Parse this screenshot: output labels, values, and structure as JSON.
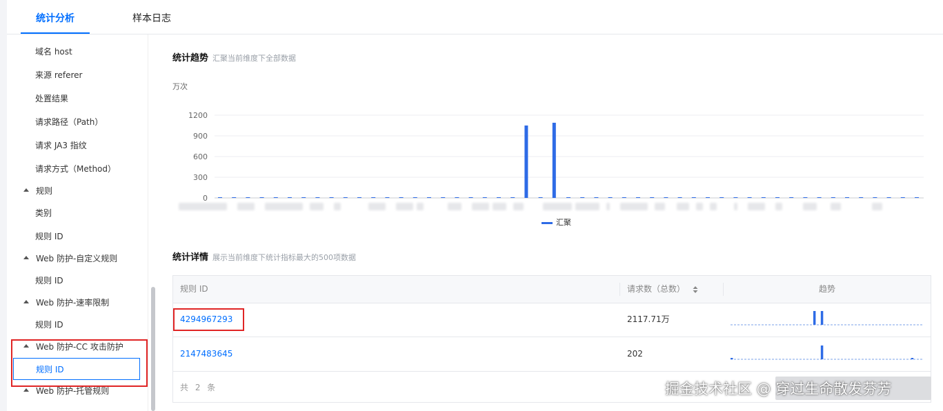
{
  "tabs": [
    {
      "label": "统计分析"
    },
    {
      "label": "样本日志"
    }
  ],
  "sidebar": {
    "items": [
      {
        "label": "域名 host"
      },
      {
        "label": "来源 referer"
      },
      {
        "label": "处置结果"
      },
      {
        "label": "请求路径（Path）"
      },
      {
        "label": "请求 JA3 指纹"
      },
      {
        "label": "请求方式（Method）"
      },
      {
        "label": "规则"
      },
      {
        "label": "类别"
      },
      {
        "label": "规则 ID"
      },
      {
        "label": "Web 防护-自定义规则"
      },
      {
        "label": "规则 ID"
      },
      {
        "label": "Web 防护-速率限制"
      },
      {
        "label": "规则 ID"
      },
      {
        "label": "Web 防护-CC 攻击防护"
      },
      {
        "label": "规则 ID"
      },
      {
        "label": "Web 防护-托管规则"
      }
    ]
  },
  "trend": {
    "title": "统计趋势",
    "subtitle": "汇聚当前维度下全部数据",
    "unit": "万次"
  },
  "chart_data": {
    "type": "bar",
    "yticks": [
      "1200",
      "900",
      "600",
      "300",
      "0"
    ],
    "ylim": [
      0,
      1200
    ],
    "grid": true,
    "legend_position": "bottom",
    "series": [
      {
        "name": "汇聚",
        "color": "#2e6be6",
        "values": [
          0,
          0,
          0,
          0,
          0,
          0,
          0,
          0,
          0,
          0,
          0,
          0,
          0,
          0,
          0,
          0,
          0,
          0,
          0,
          0,
          0,
          0,
          1050,
          0,
          1090,
          0,
          0,
          0,
          0,
          0,
          0,
          0,
          0,
          0,
          0,
          0,
          0,
          0,
          0,
          0,
          0,
          0,
          0,
          0,
          0,
          0,
          0,
          0,
          0,
          0,
          0
        ]
      }
    ]
  },
  "details": {
    "title": "统计详情",
    "subtitle": "展示当前维度下统计指标最大的500项数据",
    "columns": {
      "rule_id": "规则 ID",
      "requests": "请求数（总数）",
      "trend": "趋势"
    },
    "sort_icon": "sort-icon",
    "rows": [
      {
        "rule_id": "4294967293",
        "requests": "2117.71万",
        "spark": [
          0,
          0,
          0,
          0,
          0,
          0,
          0,
          0,
          0,
          0,
          0,
          0,
          0,
          0,
          0,
          0,
          0,
          0,
          0,
          0,
          0,
          0,
          1,
          0,
          1,
          0,
          0,
          0,
          0,
          0,
          0,
          0,
          0,
          0,
          0,
          0,
          0,
          0,
          0,
          0,
          0,
          0,
          0,
          0,
          0,
          0,
          0,
          0,
          0,
          0,
          0
        ]
      },
      {
        "rule_id": "2147483645",
        "requests": "202",
        "spark": [
          0.05,
          0,
          0,
          0,
          0,
          0,
          0,
          0,
          0,
          0,
          0,
          0,
          0,
          0,
          0,
          0,
          0,
          0,
          0,
          0,
          0,
          0,
          0,
          0,
          1,
          0,
          0,
          0,
          0,
          0,
          0,
          0,
          0,
          0,
          0,
          0,
          0,
          0,
          0,
          0,
          0,
          0,
          0,
          0,
          0,
          0,
          0,
          0,
          0.1,
          0,
          0
        ]
      }
    ],
    "total": "共 2 条"
  },
  "watermark": "掘金技术社区 @ 穿过生命散发芬芳",
  "colors": {
    "accent": "#006eff",
    "bar": "#2e6be6",
    "highlight": "#e02424"
  }
}
